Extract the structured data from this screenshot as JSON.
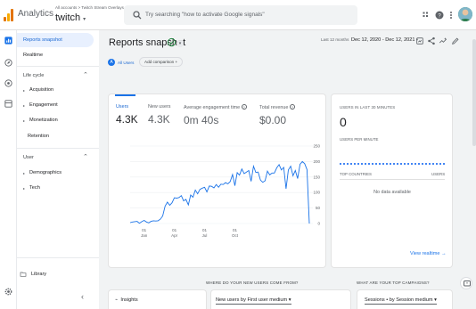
{
  "header": {
    "app_name": "Analytics",
    "breadcrumb": "All accounts > Twitch Stream Overlays",
    "property": "twitch",
    "search_placeholder": "Try searching \"how to activate Google signals\""
  },
  "sidebar": {
    "items": [
      {
        "label": "Reports snapshot",
        "selected": true
      },
      {
        "label": "Realtime"
      }
    ],
    "lifecycle": {
      "label": "Life cycle",
      "items": [
        "Acquisition",
        "Engagement",
        "Monetization",
        "Retention"
      ]
    },
    "user": {
      "label": "User",
      "items": [
        "Demographics",
        "Tech"
      ]
    },
    "library": "Library"
  },
  "page": {
    "title": "Reports snapshot",
    "date_prefix": "Last 12 months",
    "date_range": "Dec 12, 2020 - Dec 12, 2021",
    "all_users": "All Users",
    "add_comparison": "Add comparison"
  },
  "metrics": [
    {
      "label": "Users",
      "value": "4.3K"
    },
    {
      "label": "New users",
      "value": "4.3K"
    },
    {
      "label": "Average engagement time",
      "value": "0m 40s"
    },
    {
      "label": "Total revenue",
      "value": "$0.00"
    }
  ],
  "realtime": {
    "title": "USERS IN LAST 30 MINUTES",
    "value": "0",
    "per_minute": "USERS PER MINUTE",
    "top_countries": "TOP COUNTRIES",
    "users_col": "USERS",
    "no_data": "No data available",
    "view_link": "View realtime"
  },
  "bottom": {
    "where_heading": "WHERE DO YOUR NEW USERS COME FROM?",
    "campaigns_heading": "WHAT ARE YOUR TOP CAMPAIGNS?",
    "insights": "Insights",
    "new_users_dd": "New users by First user medium",
    "sessions_dd": "Sessions • by Session medium"
  },
  "chart_data": {
    "type": "line",
    "series": [
      {
        "values": [
          3,
          5,
          6,
          7,
          1,
          6,
          10,
          5,
          2,
          7,
          9,
          8,
          9,
          14,
          24,
          56,
          69,
          59,
          67,
          83,
          82,
          84,
          90,
          73,
          78,
          60,
          92,
          85,
          108,
          96,
          110,
          114,
          117,
          102,
          121,
          120,
          115,
          126,
          117,
          127,
          126,
          132,
          128,
          135,
          158,
          122,
          164,
          156,
          176,
          161,
          166,
          171,
          136,
          185,
          165,
          166,
          140,
          133,
          138,
          169,
          157,
          163,
          163,
          180,
          190,
          173,
          181,
          112,
          173,
          185,
          154,
          171,
          145,
          191,
          200,
          193,
          174,
          0
        ]
      }
    ],
    "x_ticks": [
      {
        "idx": 6,
        "label": "01\nJan"
      },
      {
        "idx": 19,
        "label": "01\nApr"
      },
      {
        "idx": 32,
        "label": "01\nJul"
      },
      {
        "idx": 45,
        "label": "01\nOct"
      }
    ],
    "y_ticks": [
      0,
      50,
      100,
      150,
      200,
      250
    ],
    "ylim": [
      0,
      250
    ]
  }
}
